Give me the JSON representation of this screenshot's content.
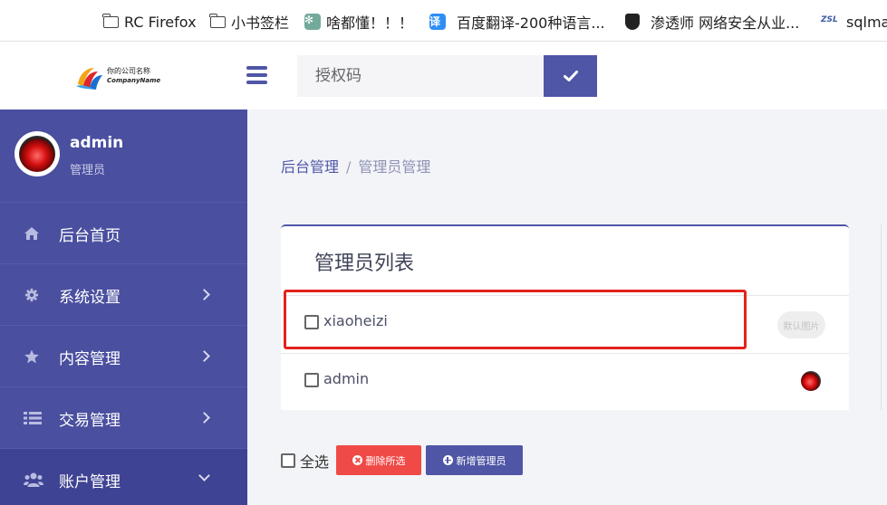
{
  "bookmarks": [
    {
      "label": "RC Firefox",
      "icon": "folder-icon"
    },
    {
      "label": "小书签栏",
      "icon": "folder-icon"
    },
    {
      "label": "啥都懂！！！",
      "icon": "chatgpt-icon"
    },
    {
      "label": "百度翻译-200种语言...",
      "icon": "translate-icon",
      "icon_text": "译"
    },
    {
      "label": "渗透师 网络安全从业...",
      "icon": "shield-icon"
    },
    {
      "label": "sqlma",
      "icon": "zsl-icon",
      "icon_text": "ZSL"
    }
  ],
  "header": {
    "logo_cn": "你的公司名称",
    "logo_en": "CompanyName",
    "auth_placeholder": "授权码",
    "auth_value": ""
  },
  "user": {
    "name": "admin",
    "role": "管理员"
  },
  "sidebar": {
    "items": [
      {
        "label": "后台首页",
        "icon": "home-icon",
        "has_arrow": false
      },
      {
        "label": "系统设置",
        "icon": "gear-icon",
        "has_arrow": true
      },
      {
        "label": "内容管理",
        "icon": "star-icon",
        "has_arrow": true
      },
      {
        "label": "交易管理",
        "icon": "list-icon",
        "has_arrow": true
      },
      {
        "label": "账户管理",
        "icon": "users-icon",
        "has_arrow": true,
        "expanded": true
      }
    ]
  },
  "breadcrumb": {
    "root": "后台管理",
    "separator": "/",
    "current": "管理员管理"
  },
  "card": {
    "title": "管理员列表",
    "rows": [
      {
        "name": "xiaoheizi",
        "image": "默认图片"
      },
      {
        "name": "admin",
        "image": ""
      }
    ]
  },
  "actions": {
    "select_all": "全选",
    "delete_selected": "删除所选",
    "add_admin": "新增管理员"
  },
  "colors": {
    "primary": "#4f56a6",
    "sidebar": "#4a4f9f",
    "danger": "#f04a46",
    "highlight": "#e3231c"
  }
}
